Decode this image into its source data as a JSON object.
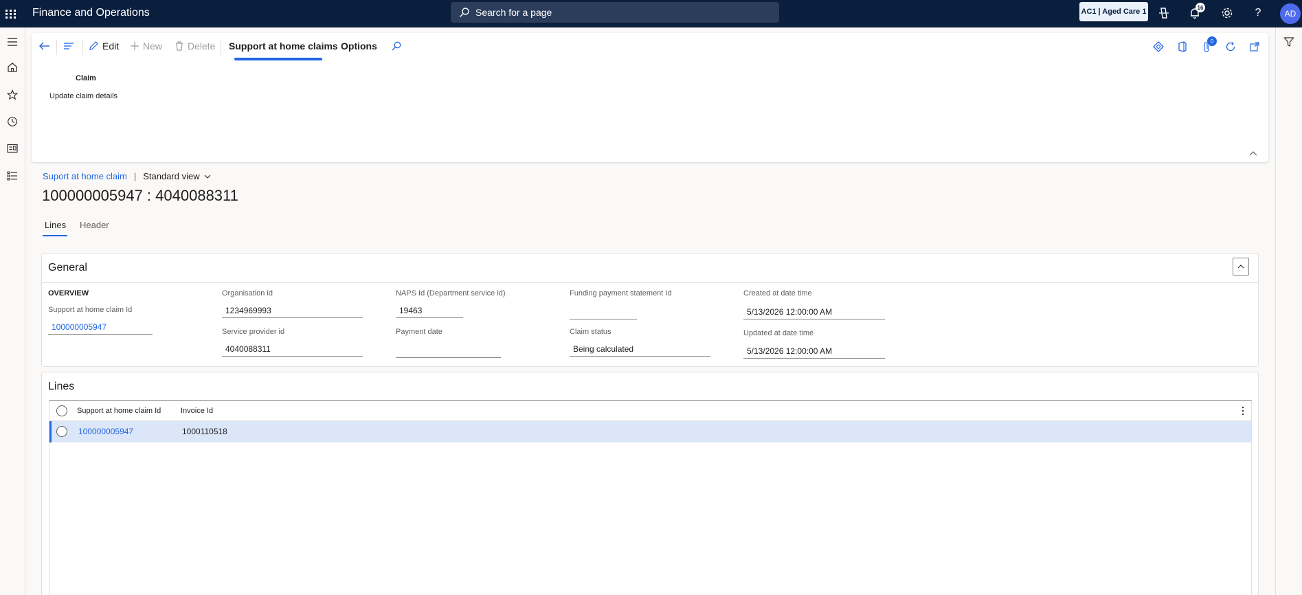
{
  "app": {
    "title": "Finance and Operations",
    "search_placeholder": "Search for a page",
    "company": "AC1 | Aged Care 1",
    "notifications_count": "16",
    "user_initials": "AD"
  },
  "action_pane": {
    "edit": "Edit",
    "new": "New",
    "delete": "Delete",
    "tab_active": "Support at home claims",
    "tab_options": "Options",
    "group_title": "Claim",
    "group_item": "Update claim details",
    "attachments_count": "0"
  },
  "breadcrumb": {
    "link": "Suport at home claim",
    "separator": "|",
    "view": "Standard view"
  },
  "page_title": "100000005947 : 4040088311",
  "tabs": {
    "lines": "Lines",
    "header": "Header"
  },
  "general": {
    "title": "General",
    "overview_label": "OVERVIEW",
    "fields": {
      "claim_id_label": "Support at home claim Id",
      "claim_id_value": "100000005947",
      "org_id_label": "Organisation id",
      "org_id_value": "1234969993",
      "service_provider_label": "Service provider id",
      "service_provider_value": "4040088311",
      "naps_label": "NAPS Id (Department service id)",
      "naps_value": "19463",
      "payment_date_label": "Payment date",
      "payment_date_value": "",
      "funding_label": "Funding payment statement Id",
      "funding_value": "",
      "claim_status_label": "Claim status",
      "claim_status_value": "Being calculated",
      "created_label": "Created at date time",
      "created_value": "5/13/2026 12:00:00 AM",
      "updated_label": "Updated at date time",
      "updated_value": "5/13/2026 12:00:00 AM"
    }
  },
  "lines": {
    "title": "Lines",
    "columns": [
      "Support at home claim Id",
      "Invoice Id"
    ],
    "rows": [
      [
        "100000005947",
        "1000110518"
      ]
    ]
  }
}
